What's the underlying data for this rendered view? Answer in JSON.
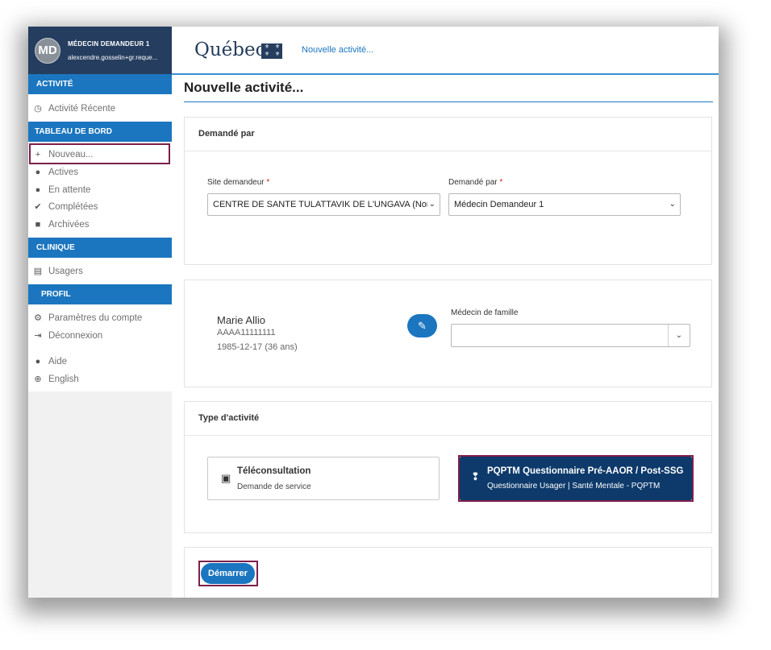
{
  "user": {
    "initials": "MD",
    "name": "MÉDECIN DEMANDEUR 1",
    "email": "alexcendre.gosselin+gr.reque..."
  },
  "sidebar": {
    "sections": {
      "activite": "ACTIVITÉ",
      "tableau": "TABLEAU DE BORD",
      "clinique": "CLINIQUE",
      "profil": "PROFIL"
    },
    "items": {
      "recente": "Activité Récente",
      "nouveau": "Nouveau...",
      "actives": "Actives",
      "attente": "En attente",
      "completees": "Complétées",
      "archivees": "Archivées",
      "usagers": "Usagers",
      "parametres": "Paramètres du compte",
      "deconnexion": "Déconnexion",
      "aide": "Aide",
      "english": "English"
    }
  },
  "header": {
    "logo": "Québec",
    "nav_link": "Nouvelle activité..."
  },
  "page": {
    "title": "Nouvelle activité..."
  },
  "demande": {
    "heading": "Demandé par",
    "site_label": "Site demandeur",
    "site_value": "CENTRE DE SANTE TULATTAVIK DE L'UNGAVA (Nord",
    "par_label": "Demandé par",
    "par_value": "Médecin Demandeur 1",
    "required_mark": "*"
  },
  "patient": {
    "name": "Marie Allio",
    "id": "AAAA11111111",
    "dob": "1985-12-17 (36 ans)",
    "medecin_label": "Médecin de famille",
    "medecin_value": ""
  },
  "type": {
    "heading": "Type d'activité",
    "options": [
      {
        "title": "Téléconsultation",
        "subtitle": "Demande de service"
      },
      {
        "title": "PQPTM Questionnaire Pré-AAOR / Post-SSG",
        "subtitle": "Questionnaire Usager | Santé Mentale - PQPTM"
      }
    ]
  },
  "actions": {
    "start": "Démarrer"
  },
  "colors": {
    "sidebar_user_bg": "#253d5e",
    "section_bg": "#1b76bf",
    "selected_card_bg": "#0d3a6b",
    "highlight": "#7d1f4b"
  }
}
